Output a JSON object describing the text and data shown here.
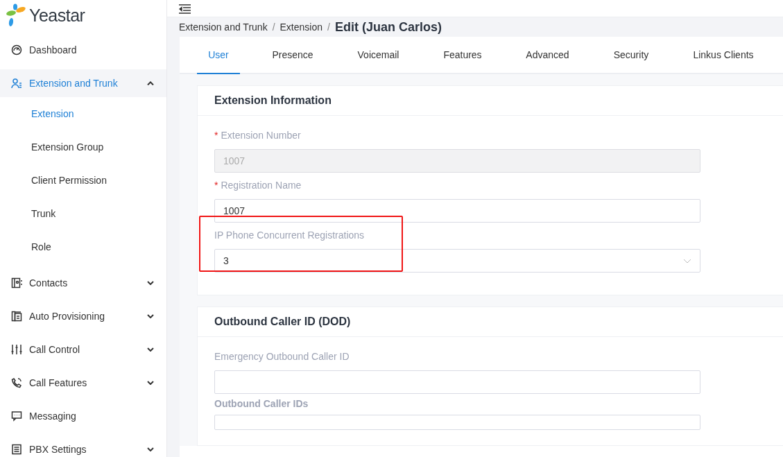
{
  "logo": {
    "text": "Yeastar"
  },
  "sidebar": {
    "items": [
      {
        "label": "Dashboard",
        "selected": false
      },
      {
        "label": "Extension and Trunk",
        "expanded": true,
        "selected": true,
        "children": [
          {
            "label": "Extension",
            "selected": true
          },
          {
            "label": "Extension Group",
            "selected": false
          },
          {
            "label": "Client Permission",
            "selected": false
          },
          {
            "label": "Trunk",
            "selected": false
          },
          {
            "label": "Role",
            "selected": false
          }
        ]
      },
      {
        "label": "Contacts",
        "expanded": false,
        "selected": false
      },
      {
        "label": "Auto Provisioning",
        "expanded": false,
        "selected": false
      },
      {
        "label": "Call Control",
        "expanded": false,
        "selected": false
      },
      {
        "label": "Call Features",
        "expanded": false,
        "selected": false
      },
      {
        "label": "Messaging",
        "selected": false
      },
      {
        "label": "PBX Settings",
        "expanded": false,
        "selected": false
      }
    ]
  },
  "breadcrumb": [
    {
      "kind": "link",
      "text": "Extension and Trunk"
    },
    {
      "kind": "separator",
      "text": "/"
    },
    {
      "kind": "link",
      "text": "Extension"
    },
    {
      "kind": "separator",
      "text": "/"
    },
    {
      "kind": "current",
      "text": "Edit (Juan Carlos)"
    }
  ],
  "tabs": [
    {
      "label": "User",
      "selected": true
    },
    {
      "label": "Presence",
      "selected": false
    },
    {
      "label": "Voicemail",
      "selected": false
    },
    {
      "label": "Features",
      "selected": false
    },
    {
      "label": "Advanced",
      "selected": false
    },
    {
      "label": "Security",
      "selected": false
    },
    {
      "label": "Linkus Clients",
      "selected": false
    }
  ],
  "sections": [
    {
      "title": "Extension Information",
      "fields": [
        {
          "kind": "input",
          "required_mark": "*",
          "label": "Extension Number",
          "disabled": true,
          "value": "1007"
        },
        {
          "kind": "input",
          "required_mark": "*",
          "label": "Registration Name",
          "disabled": false,
          "value": "1007"
        },
        {
          "kind": "select",
          "label": "IP Phone Concurrent Registrations",
          "value": "3",
          "highlighted": true
        }
      ]
    },
    {
      "title": "Outbound Caller ID (DOD)",
      "fields": [
        {
          "kind": "input",
          "label": "Emergency Outbound Caller ID",
          "disabled": false
        },
        {
          "kind": "heading",
          "label": "Outbound Caller IDs"
        }
      ]
    }
  ]
}
